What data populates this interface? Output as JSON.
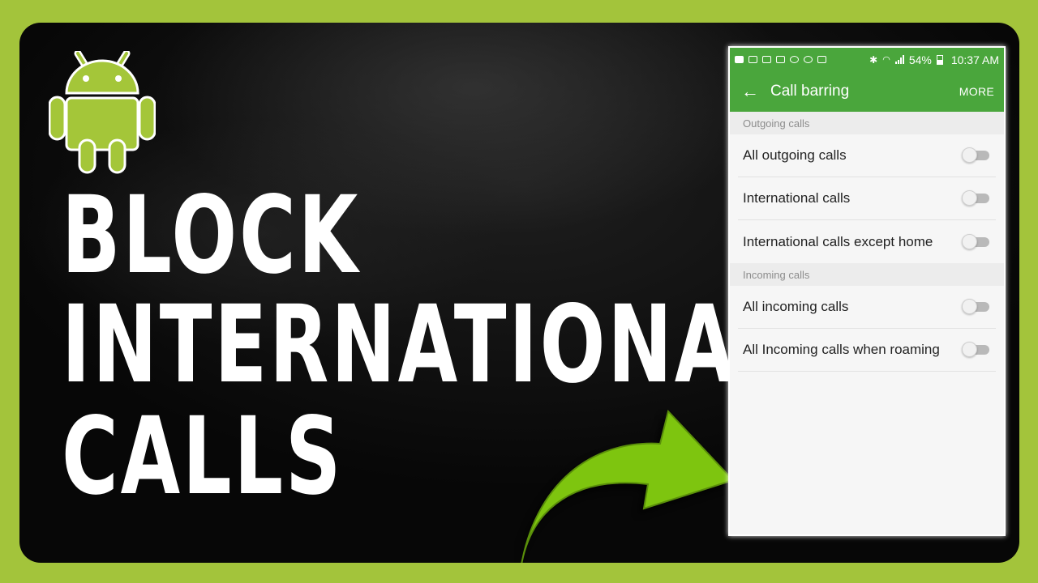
{
  "headline": {
    "line1": "BLOCK",
    "line2": "INTERNATIONAL",
    "line3": "CALLS"
  },
  "colors": {
    "border_green": "#a3c43b",
    "android_green": "#a4c639",
    "arrow_green": "#7ec50f",
    "app_bar_green": "#4aa63c"
  },
  "icons": {
    "logo": "android-robot-icon",
    "pointer": "curved-arrow-icon"
  },
  "phone": {
    "status_bar": {
      "battery": "54%",
      "time": "10:37 AM"
    },
    "toolbar": {
      "title": "Call barring",
      "more": "MORE"
    },
    "sections": [
      {
        "header": "Outgoing calls",
        "items": [
          {
            "label": "All outgoing calls",
            "enabled": false
          },
          {
            "label": "International calls",
            "enabled": false
          },
          {
            "label": "International calls except home",
            "enabled": false
          }
        ]
      },
      {
        "header": "Incoming calls",
        "items": [
          {
            "label": "All incoming calls",
            "enabled": false
          },
          {
            "label": "All Incoming calls when roaming",
            "enabled": false
          }
        ]
      }
    ]
  }
}
